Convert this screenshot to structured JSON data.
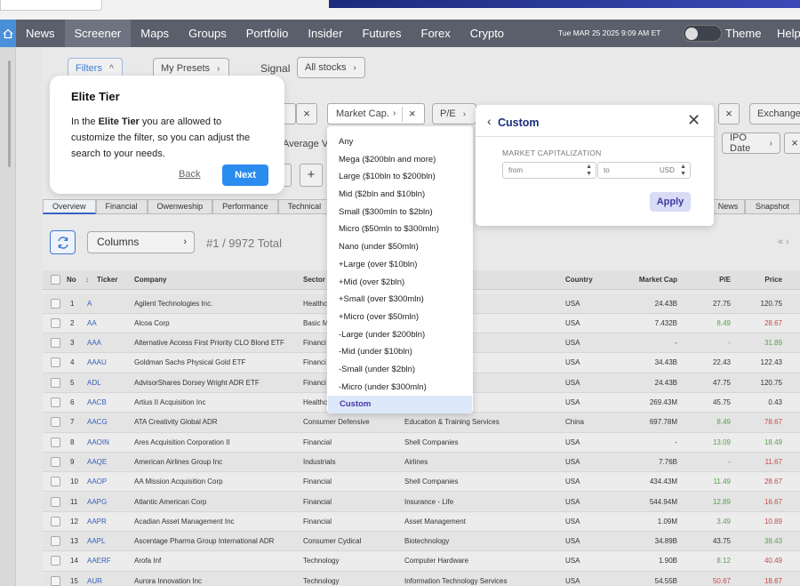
{
  "nav": {
    "items": [
      "News",
      "Screener",
      "Maps",
      "Groups",
      "Portfolio",
      "Insider",
      "Futures",
      "Forex",
      "Crypto"
    ],
    "active": "Screener",
    "date": "Tue MAR 25 2025 9:09 AM ET",
    "theme_label": "Theme",
    "help_label": "Help"
  },
  "filterbar": {
    "filters_label": "Filters",
    "presets_label": "My Presets",
    "signal_label": "Signal",
    "signal_value": "All stocks",
    "avg_volume_partial": "Average Vo",
    "pe_label": "P/E",
    "exchange_label": "Exchange",
    "ipo_label": "IPO Date",
    "add_label": "+"
  },
  "tabs": [
    "Overview",
    "Financial",
    "Owenweship",
    "Performance",
    "Technical"
  ],
  "right_tabs": [
    "News",
    "Snapshot"
  ],
  "controls": {
    "columns_label": "Columns",
    "count_text": "#1 / 9972 Total",
    "pager_text": "« ‹"
  },
  "tooltip": {
    "title": "Elite Tier",
    "body_prefix": "In the ",
    "body_bold": "Elite Tier",
    "body_suffix": " you are allowed to customize the filter, so you can adjust the search to your needs.",
    "back_label": "Back",
    "next_label": "Next"
  },
  "mcap_pill": {
    "label": "Market Cap."
  },
  "dropdown": {
    "options": [
      "Any",
      "Mega ($200bln and more)",
      "Large ($10bln to $200bln)",
      "Mid ($2bln and $10bln)",
      "Small ($300mln to $2bln)",
      "Micro ($50mln to $300mln)",
      "Nano (under $50mln)",
      "+Large (over $10bln)",
      "+Mid (over $2bln)",
      "+Small (over $300mln)",
      "+Micro (over $50mln)",
      "-Large (under $200bln)",
      "-Mid (under $10bln)",
      "-Small (under $2bln)",
      "-Micro (under $300mln)",
      "Custom"
    ],
    "selected": "Custom"
  },
  "custom_panel": {
    "title": "Custom",
    "section_label": "MARKET CAPITALIZATION",
    "from_placeholder": "from",
    "to_placeholder": "to",
    "currency": "USD",
    "apply_label": "Apply"
  },
  "table": {
    "headers": {
      "no": "No",
      "ticker": "Ticker",
      "company": "Company",
      "sector": "Sector",
      "country": "Country",
      "market_cap": "Market Cap",
      "pe": "P/E",
      "price": "Price"
    },
    "rows": [
      {
        "no": "1",
        "ticker": "A",
        "company": "Agilent Technologies Inc.",
        "sector": "Healthc",
        "industry": "rch",
        "country": "USA",
        "mcap": "24.43B",
        "pe": "27.75",
        "price": "120.75",
        "pe_color": "",
        "price_color": ""
      },
      {
        "no": "2",
        "ticker": "AA",
        "company": "Alcoa Corp",
        "sector": "Basic M",
        "industry": "",
        "country": "USA",
        "mcap": "7.432B",
        "pe": "8.49",
        "price": "28.67",
        "pe_color": "green",
        "price_color": "red"
      },
      {
        "no": "3",
        "ticker": "AAA",
        "company": "Alternative Access First Priority CLO Blond ETF",
        "sector": "Financi",
        "industry": "nd",
        "country": "USA",
        "mcap": "-",
        "pe": "-",
        "price": "31.89",
        "pe_color": "green",
        "price_color": "green"
      },
      {
        "no": "4",
        "ticker": "AAAU",
        "company": "Goldman Sachs Physical Gold ETF",
        "sector": "Financi",
        "industry": "nd",
        "country": "USA",
        "mcap": "34.43B",
        "pe": "22.43",
        "price": "122.43",
        "pe_color": "",
        "price_color": ""
      },
      {
        "no": "5",
        "ticker": "ADL",
        "company": "AdvisorShares Dorsey Wright ADR ETF",
        "sector": "Financi",
        "industry": "",
        "country": "USA",
        "mcap": "24.43B",
        "pe": "47.75",
        "price": "120.75",
        "pe_color": "",
        "price_color": ""
      },
      {
        "no": "6",
        "ticker": "AACB",
        "company": "Artius II Acquisition Inc",
        "sector": "Healthc",
        "industry": "rch",
        "country": "USA",
        "mcap": "269.43M",
        "pe": "45.75",
        "price": "0.43",
        "pe_color": "",
        "price_color": ""
      },
      {
        "no": "7",
        "ticker": "AACG",
        "company": "ATA Creativity Global ADR",
        "sector": "Consumer Defensive",
        "industry": "Education & Training Services",
        "country": "China",
        "mcap": "697.78M",
        "pe": "8.49",
        "price": "78.67",
        "pe_color": "green",
        "price_color": "red"
      },
      {
        "no": "8",
        "ticker": "AAOIN",
        "company": "Ares Acquisition Corporation II",
        "sector": "Financial",
        "industry": "Shell Companies",
        "country": "USA",
        "mcap": "-",
        "pe": "13.09",
        "price": "18.49",
        "pe_color": "green",
        "price_color": "green"
      },
      {
        "no": "9",
        "ticker": "AAQE",
        "company": "American Airlines Group Inc",
        "sector": "Industrials",
        "industry": "Airlines",
        "country": "USA",
        "mcap": "7.76B",
        "pe": "-",
        "price": "11.67",
        "pe_color": "red",
        "price_color": "red"
      },
      {
        "no": "10",
        "ticker": "AAOP",
        "company": "AA Mission Acquisition Corp",
        "sector": "Financial",
        "industry": "Shell Companies",
        "country": "USA",
        "mcap": "434.43M",
        "pe": "11.49",
        "price": "28.67",
        "pe_color": "green",
        "price_color": "red"
      },
      {
        "no": "11",
        "ticker": "AAPG",
        "company": "Atlantic American Corp",
        "sector": "Financial",
        "industry": "Insurance - Life",
        "country": "USA",
        "mcap": "544.94M",
        "pe": "12.89",
        "price": "16.67",
        "pe_color": "green",
        "price_color": "red"
      },
      {
        "no": "12",
        "ticker": "AAPR",
        "company": "Acadian Asset Management Inc",
        "sector": "Financial",
        "industry": "Asset Management",
        "country": "USA",
        "mcap": "1.09M",
        "pe": "3.49",
        "price": "10.89",
        "pe_color": "green",
        "price_color": "red"
      },
      {
        "no": "13",
        "ticker": "AAPL",
        "company": "Ascentage Pharma Group International ADR",
        "sector": "Consumer Cydical",
        "industry": "Biotechnology",
        "country": "USA",
        "mcap": "34.89B",
        "pe": "43.75",
        "price": "38.43",
        "pe_color": "",
        "price_color": "green"
      },
      {
        "no": "14",
        "ticker": "AAERF",
        "company": "Arofa Inf",
        "sector": "Technology",
        "industry": "Computer Hardware",
        "country": "USA",
        "mcap": "1.90B",
        "pe": "8.12",
        "price": "40.49",
        "pe_color": "green",
        "price_color": "red"
      },
      {
        "no": "15",
        "ticker": "AUR",
        "company": "Aurora Innovation Inc",
        "sector": "Technology",
        "industry": "Information Technology Services",
        "country": "USA",
        "mcap": "54.55B",
        "pe": "50.67",
        "price": "18.67",
        "pe_color": "red",
        "price_color": "red"
      }
    ]
  },
  "colors": {
    "accent": "#2b8cf0",
    "nav_bg": "#5a5f6b",
    "custom_title": "#1a2e7a",
    "positive": "#5aa050",
    "negative": "#c84a4a"
  }
}
